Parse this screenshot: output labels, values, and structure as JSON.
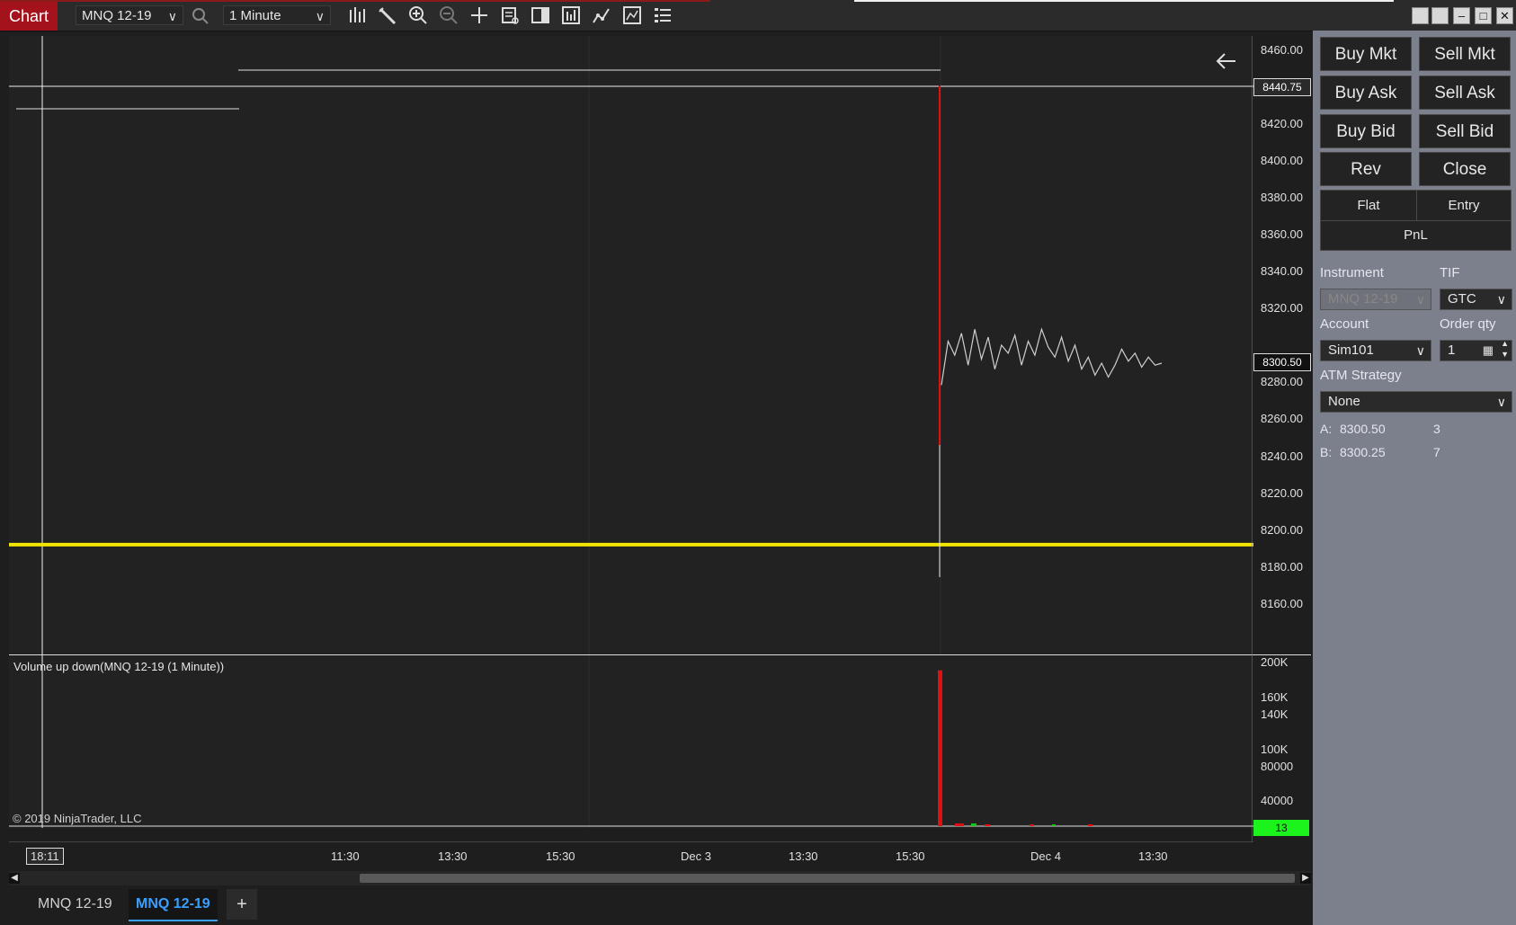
{
  "toolbar": {
    "title": "Chart",
    "instrument": "MNQ 12-19",
    "interval": "1 Minute",
    "icons": [
      "search-icon",
      "bar-type-icon",
      "draw-tool-icon",
      "zoom-in-icon",
      "zoom-out-icon",
      "crosshair-icon",
      "properties-icon",
      "chart-trader-icon",
      "data-box-icon",
      "strategies-icon",
      "indicators-icon",
      "templates-icon"
    ]
  },
  "window": {
    "buttons": [
      "tile-icon",
      "tile-icon",
      "minimize-icon",
      "maximize-icon",
      "close-icon"
    ]
  },
  "price_axis": {
    "labels": [
      "8460.00",
      "8440.00",
      "8420.00",
      "8400.00",
      "8380.00",
      "8360.00",
      "8340.00",
      "8320.00",
      "8300.00",
      "8280.00",
      "8260.00",
      "8240.00",
      "8220.00",
      "8200.00",
      "8180.00",
      "8160.00"
    ],
    "last_price_tag": "8300.50",
    "crosshair_tag": "8440.75",
    "volume_tag": "13"
  },
  "volume_axis": {
    "labels": [
      "200K",
      "160K",
      "140K",
      "100K",
      "80000",
      "40000"
    ]
  },
  "volume_panel": {
    "title": "Volume up down(MNQ 12-19 (1 Minute))",
    "copyright": "© 2019 NinjaTrader, LLC"
  },
  "time_axis": {
    "crosshair_time": "18:11",
    "labels": [
      "11:30",
      "13:30",
      "15:30",
      "Dec 3",
      "13:30",
      "15:30",
      "Dec 4",
      "13:30"
    ]
  },
  "chart_data": {
    "type": "line",
    "xlabel": "",
    "ylabel": "",
    "ylim": [
      8155,
      8465
    ],
    "horizontal_line": 8210,
    "spike": {
      "open": 8440,
      "low": 8260,
      "close": 8290
    },
    "y": [
      8290,
      8312,
      8305,
      8316,
      8300,
      8318,
      8303,
      8314,
      8298,
      8310,
      8306,
      8315,
      8300,
      8312,
      8305,
      8318,
      8309,
      8304,
      8314,
      8302,
      8310,
      8298,
      8304,
      8295,
      8301,
      8294,
      8300,
      8308,
      8302,
      8306,
      8299,
      8304,
      8300,
      8301
    ]
  },
  "volume_data": {
    "type": "bar",
    "ylim": [
      0,
      210000
    ],
    "spike_value": 200000
  },
  "tabs": [
    "MNQ 12-19",
    "MNQ 12-19"
  ],
  "add_tab_label": "+",
  "trader": {
    "buy_mkt": "Buy Mkt",
    "sell_mkt": "Sell Mkt",
    "buy_ask": "Buy Ask",
    "sell_ask": "Sell Ask",
    "buy_bid": "Buy Bid",
    "sell_bid": "Sell Bid",
    "rev": "Rev",
    "close": "Close",
    "flat": "Flat",
    "entry": "Entry",
    "pnl": "PnL",
    "instrument_label": "Instrument",
    "instrument_value": "MNQ 12-19",
    "tif_label": "TIF",
    "tif_value": "GTC",
    "account_label": "Account",
    "account_value": "Sim101",
    "qty_label": "Order qty",
    "qty_value": "1",
    "atm_label": "ATM Strategy",
    "atm_value": "None",
    "ask_label": "A:",
    "ask_price": "8300.50",
    "ask_size": "3",
    "bid_label": "B:",
    "bid_price": "8300.25",
    "bid_size": "7"
  },
  "colors": {
    "accent_red": "#a4131b",
    "yellow_line": "#f2e600",
    "volume_tag": "#1cf21c",
    "panel_bg": "#7c7f8c"
  }
}
